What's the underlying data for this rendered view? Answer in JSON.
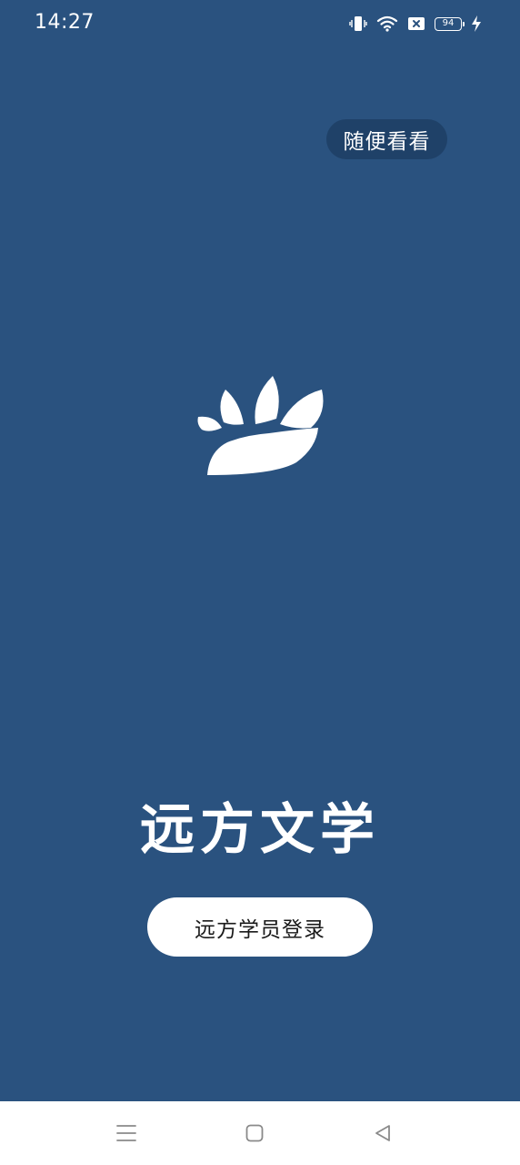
{
  "status_bar": {
    "time": "14:27",
    "battery_level": "94",
    "icons": [
      "vibrate-icon",
      "wifi-icon",
      "no-sim-icon",
      "battery-icon",
      "charging-icon"
    ]
  },
  "browse_button": {
    "label": "随便看看"
  },
  "brand": {
    "title": "远方文学",
    "logo_icon": "lotus-logo-icon"
  },
  "login_button": {
    "label": "远方学员登录"
  },
  "nav_bar": {
    "icons": [
      "menu-icon",
      "home-icon",
      "back-icon"
    ]
  },
  "colors": {
    "background": "#2a527f",
    "browse_button_bg": "#1f4168",
    "login_button_bg": "#ffffff",
    "nav_bar_bg": "#ffffff",
    "nav_icon": "#8a8a8a"
  }
}
